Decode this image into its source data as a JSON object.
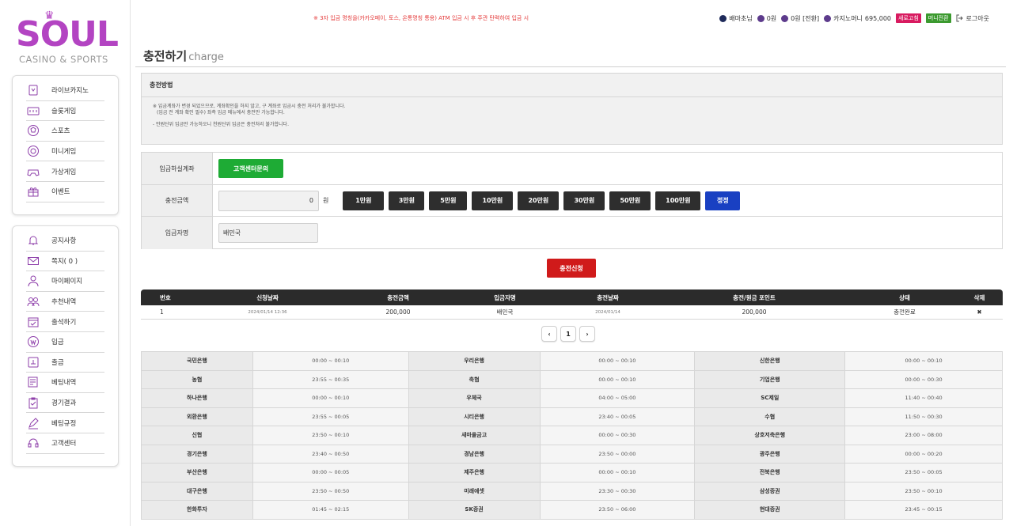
{
  "logo": {
    "main": "SOUL",
    "sub": "CASINO & SPORTS"
  },
  "top": {
    "notice": "※ 3자 입금 명칭을(카카오페이, 토스, 온통명칭 통용) ATM 입금 시 후 주관 탄력하여 입금 시",
    "user_name": "배마초님",
    "point_1": "0원",
    "point_2": "0원 [전환]",
    "casino_label": "카지노머니",
    "casino_amount": "695,000",
    "refresh_badge": "새로고침",
    "money_badge": "머니전환",
    "logout": "로그아웃"
  },
  "sidebar": {
    "group1": [
      {
        "label": "라이브카지노",
        "icon": "live-casino-icon"
      },
      {
        "label": "슬롯게임",
        "icon": "slot-icon"
      },
      {
        "label": "스포츠",
        "icon": "sports-ball-icon"
      },
      {
        "label": "미니게임",
        "icon": "mini-game-icon"
      },
      {
        "label": "가상게임",
        "icon": "gamepad-icon"
      },
      {
        "label": "이벤트",
        "icon": "gift-icon"
      }
    ],
    "group2": [
      {
        "label": "공지사항",
        "icon": "bell-icon"
      },
      {
        "label": "쪽지( 0 )",
        "icon": "mail-icon"
      },
      {
        "label": "마이페이지",
        "icon": "user-icon"
      },
      {
        "label": "추천내역",
        "icon": "users-icon"
      },
      {
        "label": "출석하기",
        "icon": "calendar-check-icon"
      },
      {
        "label": "입금",
        "icon": "deposit-coin-icon"
      },
      {
        "label": "출금",
        "icon": "withdraw-icon"
      },
      {
        "label": "베팅내역",
        "icon": "bet-history-icon"
      },
      {
        "label": "경기결과",
        "icon": "clipboard-icon"
      },
      {
        "label": "베팅규정",
        "icon": "pen-icon"
      },
      {
        "label": "고객센터",
        "icon": "headset-icon"
      }
    ]
  },
  "page": {
    "title": "충전하기",
    "subtitle": "charge"
  },
  "method": {
    "heading": "충전방법",
    "line1": "※ 입금계좌가 변경 되었으므로, 계좌확인을 하지 않고, 구 계좌로 입금시 충전 처리가 불가합니다.",
    "line2": "(입금 전 계좌 확인 필수) 좌측 입금 메뉴에서 충전만 가능합니다.",
    "line3": "- 만원단위 입금만 가능하오니 천원단위 입금은 충전처리 불가합니다."
  },
  "form": {
    "account_label": "입금하실계좌",
    "support_button": "고객센터문의",
    "amount_label": "충전금액",
    "amount_value": "0",
    "won": "원",
    "amount_buttons": [
      "1만원",
      "3만원",
      "5만원",
      "10만원",
      "20만원",
      "30만원",
      "50만원",
      "100만원"
    ],
    "correct_button": "정정",
    "depositor_label": "입금자명",
    "depositor_value": "배민국"
  },
  "submit_label": "충전신청",
  "history": {
    "headers": [
      "번호",
      "신청날짜",
      "충전금액",
      "입금자명",
      "충전날짜",
      "충전/원금 포인트",
      "상태",
      "삭제"
    ],
    "rows": [
      {
        "no": "1",
        "req_date": "2024/01/14 12:36",
        "amount": "200,000",
        "name": "배민국",
        "charge_date": "2024/01/14",
        "points": "200,000",
        "status": "충전완료",
        "delete": "✖"
      }
    ]
  },
  "pager": {
    "prev": "‹",
    "page": "1",
    "next": "›"
  },
  "banks": [
    [
      [
        "국민은행",
        "00:00 ~ 00:10"
      ],
      [
        "우리은행",
        "00:00 ~ 00:10"
      ],
      [
        "신한은행",
        "00:00 ~ 00:10"
      ]
    ],
    [
      [
        "농협",
        "23:55 ~ 00:35"
      ],
      [
        "축협",
        "00:00 ~ 00:10"
      ],
      [
        "기업은행",
        "00:00 ~ 00:30"
      ]
    ],
    [
      [
        "하나은행",
        "00:00 ~ 00:10"
      ],
      [
        "우체국",
        "04:00 ~ 05:00"
      ],
      [
        "SC제일",
        "11:40 ~ 00:40"
      ]
    ],
    [
      [
        "외환은행",
        "23:55 ~ 00:05"
      ],
      [
        "시티은행",
        "23:40 ~ 00:05"
      ],
      [
        "수협",
        "11:50 ~ 00:30"
      ]
    ],
    [
      [
        "신협",
        "23:50 ~ 00:10"
      ],
      [
        "새마을금고",
        "00:00 ~ 00:30"
      ],
      [
        "상호저축은행",
        "23:00 ~ 08:00"
      ]
    ],
    [
      [
        "경기은행",
        "23:40 ~ 00:50"
      ],
      [
        "경남은행",
        "23:50 ~ 00:00"
      ],
      [
        "광주은행",
        "00:00 ~ 00:20"
      ]
    ],
    [
      [
        "부산은행",
        "00:00 ~ 00:05"
      ],
      [
        "제주은행",
        "00:00 ~ 00:10"
      ],
      [
        "전북은행",
        "23:50 ~ 00:05"
      ]
    ],
    [
      [
        "대구은행",
        "23:50 ~ 00:50"
      ],
      [
        "미래에셋",
        "23:30 ~ 00:30"
      ],
      [
        "삼성증권",
        "23:50 ~ 00:10"
      ]
    ],
    [
      [
        "한화투자",
        "01:45 ~ 02:15"
      ],
      [
        "SK증권",
        "23:50 ~ 06:00"
      ],
      [
        "현대증권",
        "23:45 ~ 00:15"
      ]
    ]
  ]
}
